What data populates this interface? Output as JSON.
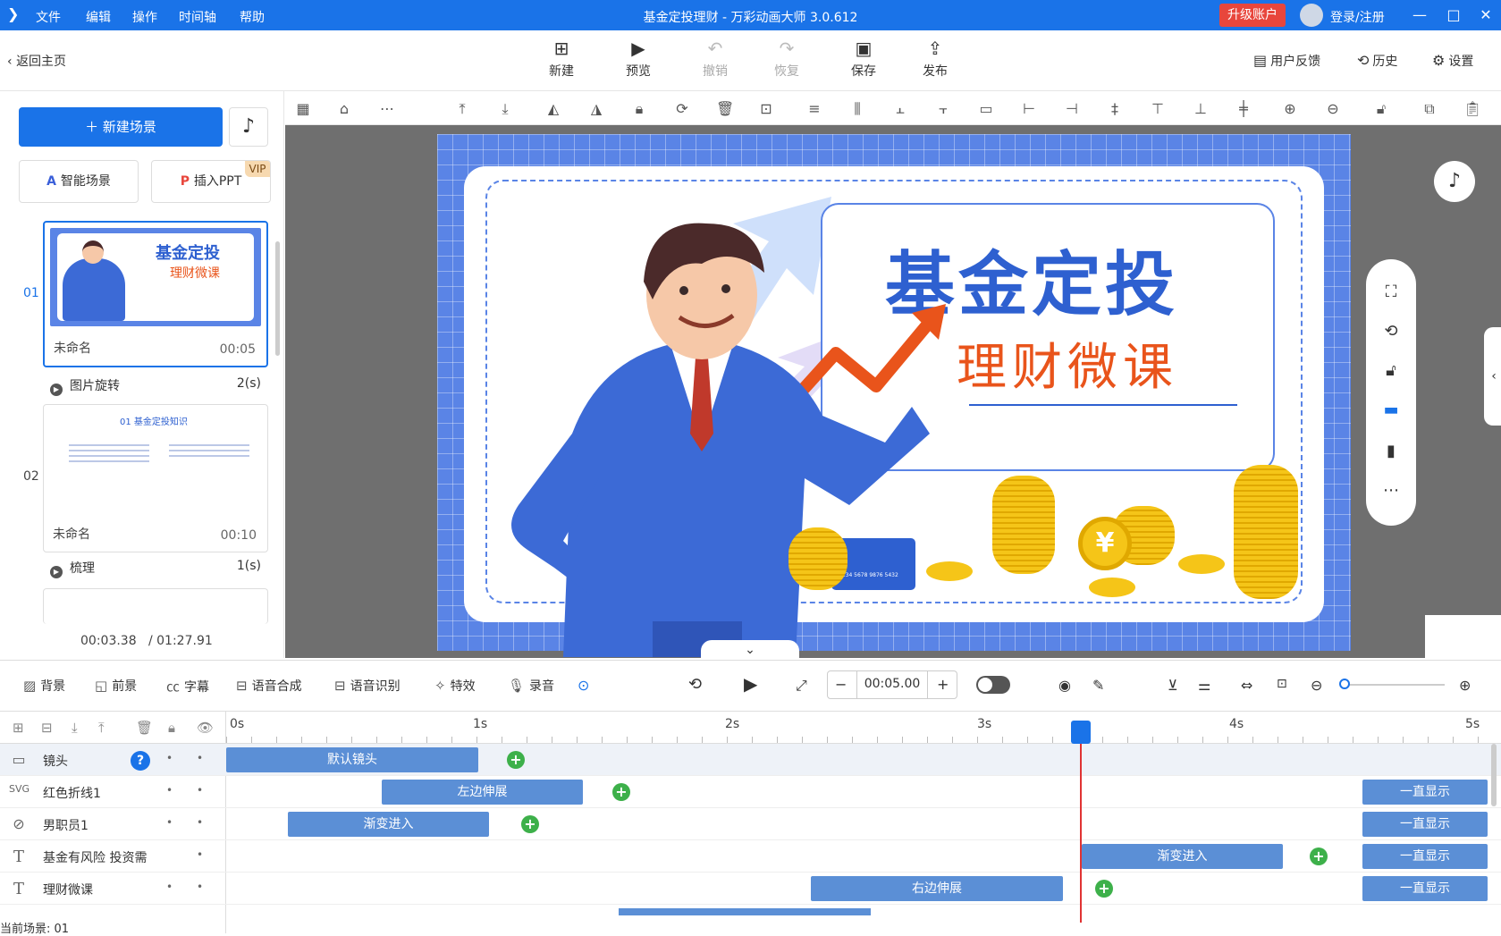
{
  "titlebar": {
    "menus": [
      "文件",
      "编辑",
      "操作",
      "时间轴",
      "帮助"
    ],
    "title": "基金定投理财 - 万彩动画大师 3.0.612",
    "upgrade": "升级账户",
    "login": "登录/注册"
  },
  "toolbar": {
    "back": "返回主页",
    "buttons": [
      {
        "label": "新建",
        "icon": "plus-square-icon"
      },
      {
        "label": "预览",
        "icon": "play-icon"
      },
      {
        "label": "撤销",
        "icon": "undo-icon"
      },
      {
        "label": "恢复",
        "icon": "redo-icon"
      },
      {
        "label": "保存",
        "icon": "save-icon"
      },
      {
        "label": "发布",
        "icon": "publish-icon"
      }
    ],
    "right": [
      {
        "label": "用户反馈",
        "icon": "feedback-icon"
      },
      {
        "label": "历史",
        "icon": "history-icon"
      },
      {
        "label": "设置",
        "icon": "settings-icon"
      }
    ]
  },
  "leftpanel": {
    "new_scene": "新建场景",
    "smart_scene": "智能场景",
    "insert_ppt": "插入PPT",
    "vip": "VIP",
    "time_current": "00:03.38",
    "time_total": "/ 01:27.91",
    "scenes": [
      {
        "index": "01",
        "name": "未命名",
        "duration": "00:05",
        "thumb_title": "基金定投",
        "thumb_sub": "理财微课",
        "transition": "图片旋转",
        "transition_time": "2(s)"
      },
      {
        "index": "02",
        "name": "未命名",
        "duration": "00:10",
        "thumb_title": "01  基金定投知识",
        "transition": "梳理",
        "transition_time": "1(s)"
      }
    ]
  },
  "stage": {
    "title": "基金定投",
    "subtitle": "理财微课",
    "card_number": "1234 5678 9876 5432",
    "coin_symbol": "¥"
  },
  "bottombar": {
    "items": [
      "背景",
      "前景",
      "字幕",
      "语音合成",
      "语音识别",
      "特效",
      "录音"
    ],
    "time": "00:05.00"
  },
  "timeline": {
    "ticks": [
      "0s",
      "1s",
      "2s",
      "3s",
      "4s",
      "5s"
    ],
    "tracks": [
      {
        "name": "镜头",
        "icon": "camera-icon",
        "clips": [
          "默认镜头"
        ]
      },
      {
        "name": "红色折线1",
        "icon": "svg-icon",
        "clips": [
          "左边伸展",
          "一直显示"
        ]
      },
      {
        "name": "男职员1",
        "icon": "compass-icon",
        "clips": [
          "渐变进入",
          "一直显示"
        ]
      },
      {
        "name": "基金有风险  投资需",
        "icon": "text-icon",
        "clips": [
          "渐变进入",
          "一直显示"
        ]
      },
      {
        "name": "理财微课",
        "icon": "text-icon",
        "clips": [
          "右边伸展",
          "一直显示"
        ]
      }
    ],
    "status": "当前场景: 01"
  },
  "colors": {
    "accent": "#1a73e8",
    "stage": "#5a84e6",
    "title": "#2e60d0",
    "subtitle": "#e9541b",
    "keyframe": "#3db04a",
    "playhead": "#e03333"
  }
}
